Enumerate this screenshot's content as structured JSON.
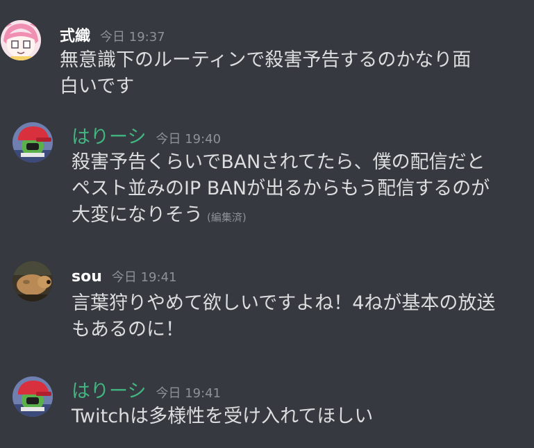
{
  "messages": [
    {
      "author": "式織",
      "timestamp": "今日 19:37",
      "lines": [
        "無意識下のルーティンで殺害予告するのかなり面",
        "白いです"
      ]
    },
    {
      "author": "はりーシ",
      "timestamp": "今日 19:40",
      "lines": [
        "殺害予告くらいでBANされてたら、僕の配信だと",
        "ペスト並みのIP BANが出るからもう配信するのが",
        "大変になりそう"
      ],
      "edited_label": "(編集済)"
    },
    {
      "author": "sou",
      "timestamp": "今日 19:41",
      "lines": [
        "言葉狩りやめて欲しいですよね！4ねが基本の放送",
        "もあるのに！"
      ]
    },
    {
      "author": "はりーシ",
      "timestamp": "今日 19:41",
      "lines": [
        "Twitchは多様性を受け入れてほしい"
      ]
    }
  ],
  "colors": {
    "background": "#36393f",
    "username_default": "#ffffff",
    "username_green": "#43b581",
    "message_text": "#dcddde",
    "timestamp": "#8e9297"
  }
}
